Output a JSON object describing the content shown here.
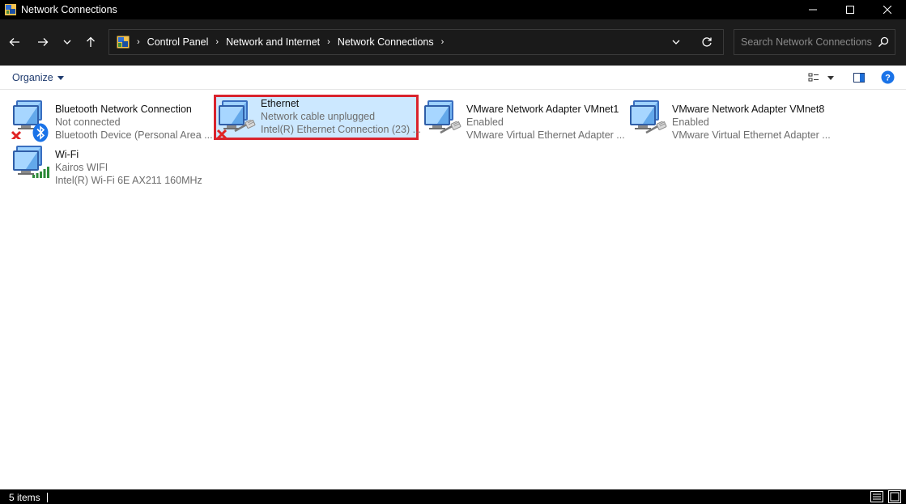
{
  "window": {
    "title": "Network Connections",
    "minimize_glyph": "—",
    "maximize_glyph": "☐",
    "close_glyph": "✕"
  },
  "nav": {
    "back_glyph": "←",
    "forward_glyph": "→",
    "recent_glyph": "⌄",
    "up_glyph": "↑",
    "refresh_glyph": "↻",
    "dropdown_glyph": "⌄",
    "breadcrumb": [
      "Control Panel",
      "Network and Internet",
      "Network Connections"
    ],
    "search_placeholder": "Search Network Connections"
  },
  "toolbar": {
    "organize_label": "Organize"
  },
  "connections": [
    {
      "name": "Bluetooth Network Connection",
      "status": "Not connected",
      "device": "Bluetooth Device (Personal Area ...",
      "badge": "bluetooth-icon",
      "error": true
    },
    {
      "name": "Ethernet",
      "status": "Network cable unplugged",
      "device": "Intel(R) Ethernet Connection (23) ...",
      "badge": "cable-icon",
      "error": true,
      "selected": true
    },
    {
      "name": "VMware Network Adapter VMnet1",
      "status": "Enabled",
      "device": "VMware Virtual Ethernet Adapter ...",
      "badge": "cable-icon",
      "error": false
    },
    {
      "name": "VMware Network Adapter VMnet8",
      "status": "Enabled",
      "device": "VMware Virtual Ethernet Adapter ...",
      "badge": "cable-icon",
      "error": false
    },
    {
      "name": "Wi-Fi",
      "status": "Kairos WIFI",
      "device": "Intel(R) Wi-Fi 6E AX211 160MHz",
      "badge": "wifi-signal-icon",
      "error": false
    }
  ],
  "statusbar": {
    "item_count": "5 items"
  },
  "colors": {
    "selection_bg": "#cce8ff",
    "selection_border": "#d9232d",
    "titlebar_bg": "#000000",
    "navbar_bg": "#1c1c1c",
    "help_blue": "#1a73e8"
  }
}
